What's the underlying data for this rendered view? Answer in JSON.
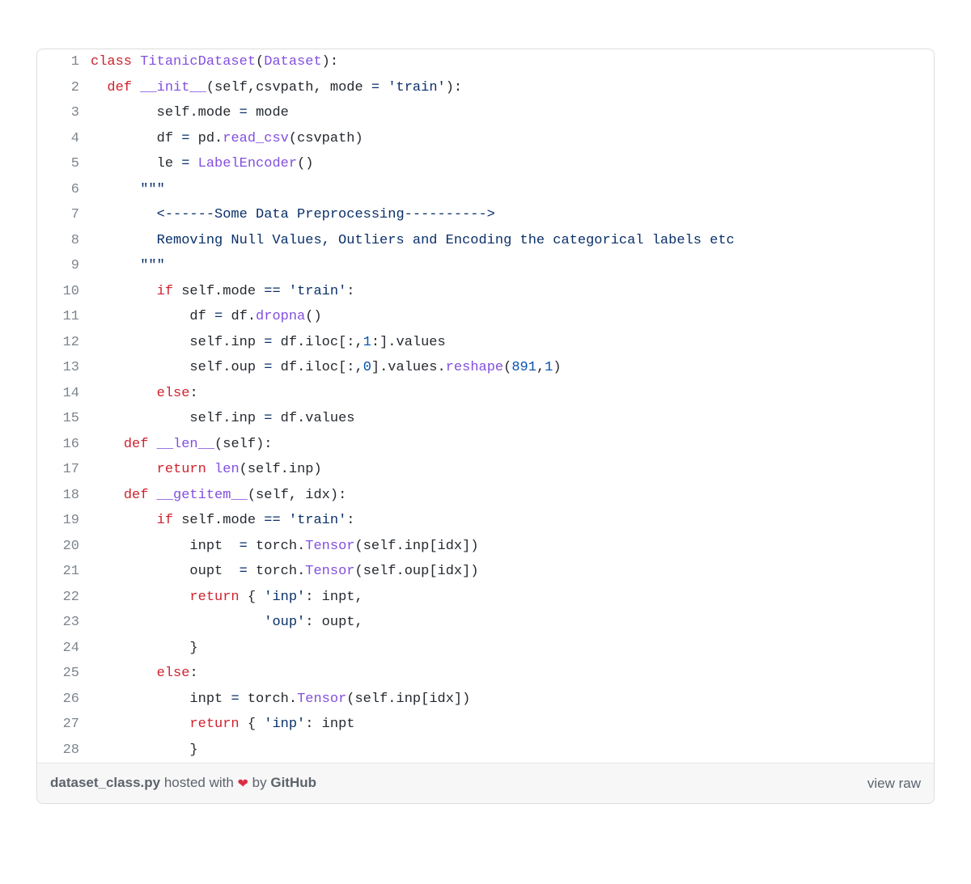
{
  "footer": {
    "filename": "dataset_class.py",
    "hosted_pre": " hosted with ",
    "heart": "❤",
    "by": " by ",
    "github": "GitHub",
    "view_raw": "view raw"
  },
  "lines": [
    {
      "n": "1",
      "tokens": [
        [
          "kw",
          "class"
        ],
        [
          "plain",
          " "
        ],
        [
          "fn",
          "TitanicDataset"
        ],
        [
          "plain",
          "("
        ],
        [
          "fn",
          "Dataset"
        ],
        [
          "plain",
          "):"
        ]
      ]
    },
    {
      "n": "2",
      "tokens": [
        [
          "plain",
          "  "
        ],
        [
          "kw",
          "def"
        ],
        [
          "plain",
          " "
        ],
        [
          "fn",
          "__init__"
        ],
        [
          "plain",
          "("
        ],
        [
          "plain",
          "self"
        ],
        [
          "plain",
          ","
        ],
        [
          "plain",
          "csvpath"
        ],
        [
          "plain",
          ", "
        ],
        [
          "plain",
          "mode"
        ],
        [
          "plain",
          " "
        ],
        [
          "op",
          "="
        ],
        [
          "plain",
          " "
        ],
        [
          "str",
          "'train'"
        ],
        [
          "plain",
          "):"
        ]
      ]
    },
    {
      "n": "3",
      "tokens": [
        [
          "plain",
          "        "
        ],
        [
          "plain",
          "self"
        ],
        [
          "plain",
          "."
        ],
        [
          "plain",
          "mode"
        ],
        [
          "plain",
          " "
        ],
        [
          "op",
          "="
        ],
        [
          "plain",
          " "
        ],
        [
          "plain",
          "mode"
        ]
      ]
    },
    {
      "n": "4",
      "tokens": [
        [
          "plain",
          "        "
        ],
        [
          "plain",
          "df"
        ],
        [
          "plain",
          " "
        ],
        [
          "op",
          "="
        ],
        [
          "plain",
          " "
        ],
        [
          "plain",
          "pd"
        ],
        [
          "plain",
          "."
        ],
        [
          "fn",
          "read_csv"
        ],
        [
          "plain",
          "("
        ],
        [
          "plain",
          "csvpath"
        ],
        [
          "plain",
          ")"
        ]
      ]
    },
    {
      "n": "5",
      "tokens": [
        [
          "plain",
          "        "
        ],
        [
          "plain",
          "le"
        ],
        [
          "plain",
          " "
        ],
        [
          "op",
          "="
        ],
        [
          "plain",
          " "
        ],
        [
          "fn",
          "LabelEncoder"
        ],
        [
          "plain",
          "()"
        ]
      ]
    },
    {
      "n": "6",
      "tokens": [
        [
          "plain",
          "      "
        ],
        [
          "str",
          "\"\"\""
        ]
      ]
    },
    {
      "n": "7",
      "tokens": [
        [
          "str",
          "        <------Some Data Preprocessing---------->"
        ]
      ]
    },
    {
      "n": "8",
      "tokens": [
        [
          "str",
          "        Removing Null Values, Outliers and Encoding the categorical labels etc"
        ]
      ]
    },
    {
      "n": "9",
      "tokens": [
        [
          "plain",
          "      "
        ],
        [
          "str",
          "\"\"\""
        ]
      ]
    },
    {
      "n": "10",
      "tokens": [
        [
          "plain",
          "        "
        ],
        [
          "kw",
          "if"
        ],
        [
          "plain",
          " "
        ],
        [
          "plain",
          "self"
        ],
        [
          "plain",
          "."
        ],
        [
          "plain",
          "mode"
        ],
        [
          "plain",
          " "
        ],
        [
          "op",
          "=="
        ],
        [
          "plain",
          " "
        ],
        [
          "str",
          "'train'"
        ],
        [
          "plain",
          ":"
        ]
      ]
    },
    {
      "n": "11",
      "tokens": [
        [
          "plain",
          "            "
        ],
        [
          "plain",
          "df"
        ],
        [
          "plain",
          " "
        ],
        [
          "op",
          "="
        ],
        [
          "plain",
          " "
        ],
        [
          "plain",
          "df"
        ],
        [
          "plain",
          "."
        ],
        [
          "fn",
          "dropna"
        ],
        [
          "plain",
          "()"
        ]
      ]
    },
    {
      "n": "12",
      "tokens": [
        [
          "plain",
          "            "
        ],
        [
          "plain",
          "self"
        ],
        [
          "plain",
          "."
        ],
        [
          "plain",
          "inp"
        ],
        [
          "plain",
          " "
        ],
        [
          "op",
          "="
        ],
        [
          "plain",
          " "
        ],
        [
          "plain",
          "df"
        ],
        [
          "plain",
          "."
        ],
        [
          "plain",
          "iloc"
        ],
        [
          "plain",
          "[:,"
        ],
        [
          "num",
          "1"
        ],
        [
          "plain",
          ":]."
        ],
        [
          "plain",
          "values"
        ]
      ]
    },
    {
      "n": "13",
      "tokens": [
        [
          "plain",
          "            "
        ],
        [
          "plain",
          "self"
        ],
        [
          "plain",
          "."
        ],
        [
          "plain",
          "oup"
        ],
        [
          "plain",
          " "
        ],
        [
          "op",
          "="
        ],
        [
          "plain",
          " "
        ],
        [
          "plain",
          "df"
        ],
        [
          "plain",
          "."
        ],
        [
          "plain",
          "iloc"
        ],
        [
          "plain",
          "[:,"
        ],
        [
          "num",
          "0"
        ],
        [
          "plain",
          "]."
        ],
        [
          "plain",
          "values"
        ],
        [
          "plain",
          "."
        ],
        [
          "fn",
          "reshape"
        ],
        [
          "plain",
          "("
        ],
        [
          "num",
          "891"
        ],
        [
          "plain",
          ","
        ],
        [
          "num",
          "1"
        ],
        [
          "plain",
          ")"
        ]
      ]
    },
    {
      "n": "14",
      "tokens": [
        [
          "plain",
          "        "
        ],
        [
          "kw",
          "else"
        ],
        [
          "plain",
          ":"
        ]
      ]
    },
    {
      "n": "15",
      "tokens": [
        [
          "plain",
          "            "
        ],
        [
          "plain",
          "self"
        ],
        [
          "plain",
          "."
        ],
        [
          "plain",
          "inp"
        ],
        [
          "plain",
          " "
        ],
        [
          "op",
          "="
        ],
        [
          "plain",
          " "
        ],
        [
          "plain",
          "df"
        ],
        [
          "plain",
          "."
        ],
        [
          "plain",
          "values"
        ]
      ]
    },
    {
      "n": "16",
      "tokens": [
        [
          "plain",
          "    "
        ],
        [
          "kw",
          "def"
        ],
        [
          "plain",
          " "
        ],
        [
          "fn",
          "__len__"
        ],
        [
          "plain",
          "("
        ],
        [
          "plain",
          "self"
        ],
        [
          "plain",
          "):"
        ]
      ]
    },
    {
      "n": "17",
      "tokens": [
        [
          "plain",
          "        "
        ],
        [
          "kw",
          "return"
        ],
        [
          "plain",
          " "
        ],
        [
          "fn",
          "len"
        ],
        [
          "plain",
          "("
        ],
        [
          "plain",
          "self"
        ],
        [
          "plain",
          "."
        ],
        [
          "plain",
          "inp"
        ],
        [
          "plain",
          ")"
        ]
      ]
    },
    {
      "n": "18",
      "tokens": [
        [
          "plain",
          "    "
        ],
        [
          "kw",
          "def"
        ],
        [
          "plain",
          " "
        ],
        [
          "fn",
          "__getitem__"
        ],
        [
          "plain",
          "("
        ],
        [
          "plain",
          "self"
        ],
        [
          "plain",
          ", "
        ],
        [
          "plain",
          "idx"
        ],
        [
          "plain",
          "):"
        ]
      ]
    },
    {
      "n": "19",
      "tokens": [
        [
          "plain",
          "        "
        ],
        [
          "kw",
          "if"
        ],
        [
          "plain",
          " "
        ],
        [
          "plain",
          "self"
        ],
        [
          "plain",
          "."
        ],
        [
          "plain",
          "mode"
        ],
        [
          "plain",
          " "
        ],
        [
          "op",
          "=="
        ],
        [
          "plain",
          " "
        ],
        [
          "str",
          "'train'"
        ],
        [
          "plain",
          ":"
        ]
      ]
    },
    {
      "n": "20",
      "tokens": [
        [
          "plain",
          "            "
        ],
        [
          "plain",
          "inpt"
        ],
        [
          "plain",
          "  "
        ],
        [
          "op",
          "="
        ],
        [
          "plain",
          " "
        ],
        [
          "plain",
          "torch"
        ],
        [
          "plain",
          "."
        ],
        [
          "fn",
          "Tensor"
        ],
        [
          "plain",
          "("
        ],
        [
          "plain",
          "self"
        ],
        [
          "plain",
          "."
        ],
        [
          "plain",
          "inp"
        ],
        [
          "plain",
          "["
        ],
        [
          "plain",
          "idx"
        ],
        [
          "plain",
          "])"
        ]
      ]
    },
    {
      "n": "21",
      "tokens": [
        [
          "plain",
          "            "
        ],
        [
          "plain",
          "oupt"
        ],
        [
          "plain",
          "  "
        ],
        [
          "op",
          "="
        ],
        [
          "plain",
          " "
        ],
        [
          "plain",
          "torch"
        ],
        [
          "plain",
          "."
        ],
        [
          "fn",
          "Tensor"
        ],
        [
          "plain",
          "("
        ],
        [
          "plain",
          "self"
        ],
        [
          "plain",
          "."
        ],
        [
          "plain",
          "oup"
        ],
        [
          "plain",
          "["
        ],
        [
          "plain",
          "idx"
        ],
        [
          "plain",
          "])"
        ]
      ]
    },
    {
      "n": "22",
      "tokens": [
        [
          "plain",
          "            "
        ],
        [
          "kw",
          "return"
        ],
        [
          "plain",
          " { "
        ],
        [
          "str",
          "'inp'"
        ],
        [
          "plain",
          ": "
        ],
        [
          "plain",
          "inpt"
        ],
        [
          "plain",
          ","
        ]
      ]
    },
    {
      "n": "23",
      "tokens": [
        [
          "plain",
          "                     "
        ],
        [
          "str",
          "'oup'"
        ],
        [
          "plain",
          ": "
        ],
        [
          "plain",
          "oupt"
        ],
        [
          "plain",
          ","
        ]
      ]
    },
    {
      "n": "24",
      "tokens": [
        [
          "plain",
          "            }"
        ]
      ]
    },
    {
      "n": "25",
      "tokens": [
        [
          "plain",
          "        "
        ],
        [
          "kw",
          "else"
        ],
        [
          "plain",
          ":"
        ]
      ]
    },
    {
      "n": "26",
      "tokens": [
        [
          "plain",
          "            "
        ],
        [
          "plain",
          "inpt"
        ],
        [
          "plain",
          " "
        ],
        [
          "op",
          "="
        ],
        [
          "plain",
          " "
        ],
        [
          "plain",
          "torch"
        ],
        [
          "plain",
          "."
        ],
        [
          "fn",
          "Tensor"
        ],
        [
          "plain",
          "("
        ],
        [
          "plain",
          "self"
        ],
        [
          "plain",
          "."
        ],
        [
          "plain",
          "inp"
        ],
        [
          "plain",
          "["
        ],
        [
          "plain",
          "idx"
        ],
        [
          "plain",
          "])"
        ]
      ]
    },
    {
      "n": "27",
      "tokens": [
        [
          "plain",
          "            "
        ],
        [
          "kw",
          "return"
        ],
        [
          "plain",
          " { "
        ],
        [
          "str",
          "'inp'"
        ],
        [
          "plain",
          ": "
        ],
        [
          "plain",
          "inpt"
        ]
      ]
    },
    {
      "n": "28",
      "tokens": [
        [
          "plain",
          "            }"
        ]
      ]
    }
  ]
}
